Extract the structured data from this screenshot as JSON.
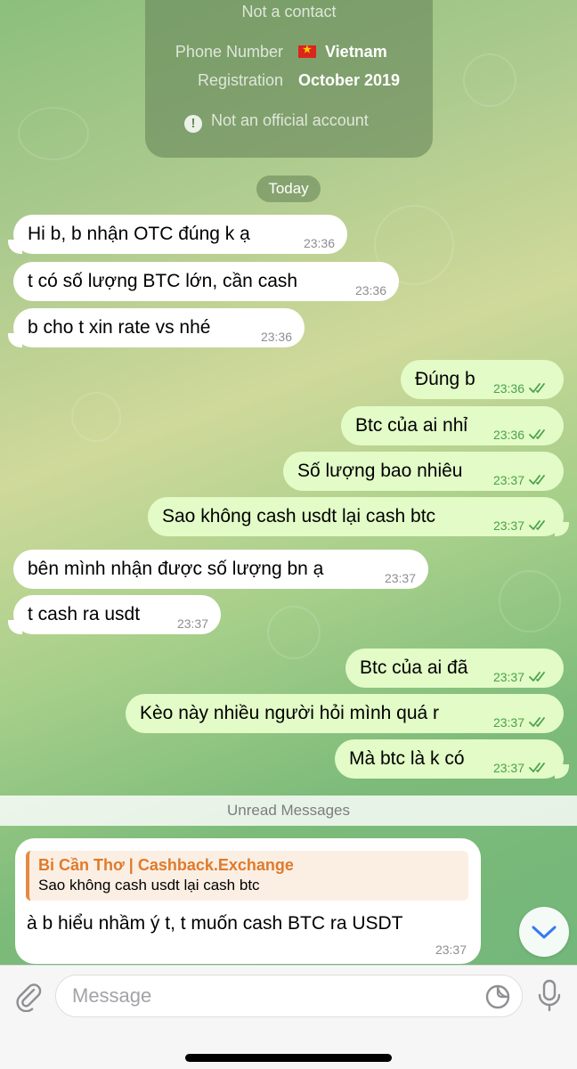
{
  "info_card": {
    "not_contact": "Not a contact",
    "phone_label": "Phone Number",
    "phone_value": "Vietnam",
    "registration_label": "Registration",
    "registration_value": "October 2019",
    "official_text": "Not an official account"
  },
  "date_pill": "Today",
  "messages": [
    {
      "dir": "in",
      "text": "Hi b, b nhận OTC đúng k ạ",
      "time": "23:36"
    },
    {
      "dir": "in",
      "text": "t có số lượng BTC lớn, cần cash",
      "time": "23:36"
    },
    {
      "dir": "in",
      "text": "b cho t xin rate vs nhé",
      "time": "23:36"
    },
    {
      "dir": "out",
      "text": "Đúng b",
      "time": "23:36",
      "read": true
    },
    {
      "dir": "out",
      "text": "Btc của ai nhỉ",
      "time": "23:36",
      "read": true
    },
    {
      "dir": "out",
      "text": "Số lượng bao nhiêu",
      "time": "23:37",
      "read": true
    },
    {
      "dir": "out",
      "text": "Sao không cash usdt lại cash btc",
      "time": "23:37",
      "read": true
    },
    {
      "dir": "in",
      "text": "bên mình nhận được số lượng bn ạ",
      "time": "23:37"
    },
    {
      "dir": "in",
      "text": "t cash ra usdt",
      "time": "23:37"
    },
    {
      "dir": "out",
      "text": "Btc của ai đã",
      "time": "23:37",
      "read": true
    },
    {
      "dir": "out",
      "text": "Kèo này nhiều người hỏi mình quá r",
      "time": "23:37",
      "read": true
    },
    {
      "dir": "out",
      "text": "Mà btc là k có",
      "time": "23:37",
      "read": true
    }
  ],
  "unread_label": "Unread Messages",
  "reply": {
    "quote_name": "Bi Cần Thơ | Cashback.Exchange",
    "quote_text": "Sao không cash usdt lại cash btc",
    "text": "à b hiểu nhầm ý t, t muốn cash BTC ra USDT",
    "time": "23:37"
  },
  "input": {
    "placeholder": "Message",
    "value": ""
  },
  "icons": {
    "attach": "paperclip-icon",
    "sticker": "sticker-icon",
    "mic": "microphone-icon",
    "scroll": "chevron-down-icon",
    "read_status": "double-check-icon"
  },
  "colors": {
    "incoming_bubble": "#ffffff",
    "outgoing_bubble": "#e2fbc7",
    "check_green": "#4aa24a",
    "quote_accent": "#e07a2b",
    "link_blue": "#3478f6"
  }
}
